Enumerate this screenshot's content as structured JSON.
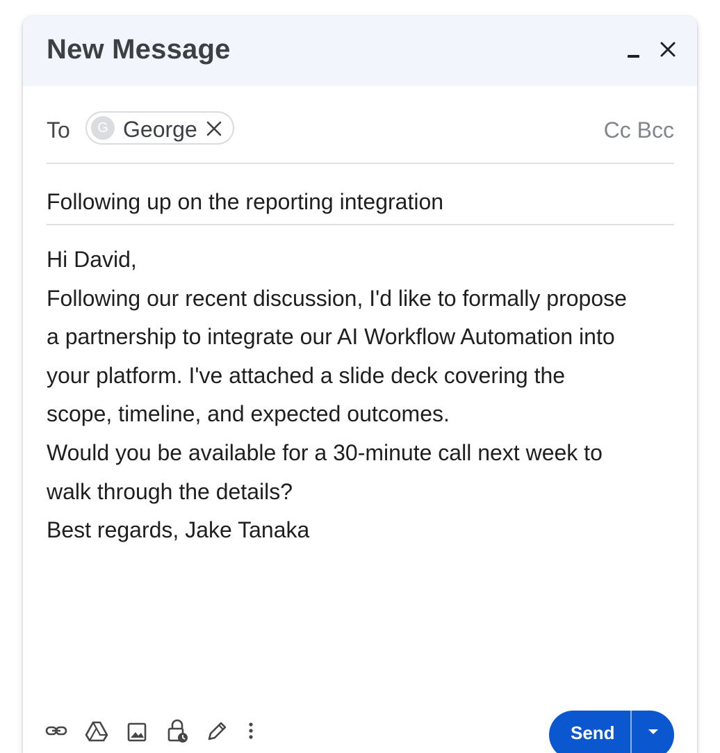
{
  "window": {
    "title": "New Message",
    "minimize_icon": "minimize-icon",
    "close_icon": "close-icon"
  },
  "recipients": {
    "to_label": "To",
    "chips": [
      {
        "initial": "G",
        "name": "George",
        "remove_icon": "close-icon"
      }
    ],
    "cc_label": "Cc",
    "bcc_label": "Bcc"
  },
  "subject": "Following up on the reporting integration",
  "body": {
    "lines": [
      "Hi David,",
      "Following our recent discussion, I'd like to formally propose",
      "a partnership to integrate our AI Workflow Automation into",
      "your platform. I've attached a slide deck covering the",
      "scope, timeline, and expected outcomes.",
      "Would you be available for a 30-minute call next week to",
      "walk through the details?",
      "Best regards, Jake Tanaka"
    ]
  },
  "toolbar": {
    "send_label": "Send",
    "more_send_options_icon": "caret-down-icon",
    "icons": [
      "link-icon",
      "drive-icon",
      "image-icon",
      "lock-clock-icon",
      "pen-icon",
      "more-vert-icon"
    ]
  },
  "colors": {
    "header_bg": "#f2f6fc",
    "send_button": "#0b57d0",
    "text_primary": "#1f1f1f",
    "text_secondary": "#80868b"
  }
}
